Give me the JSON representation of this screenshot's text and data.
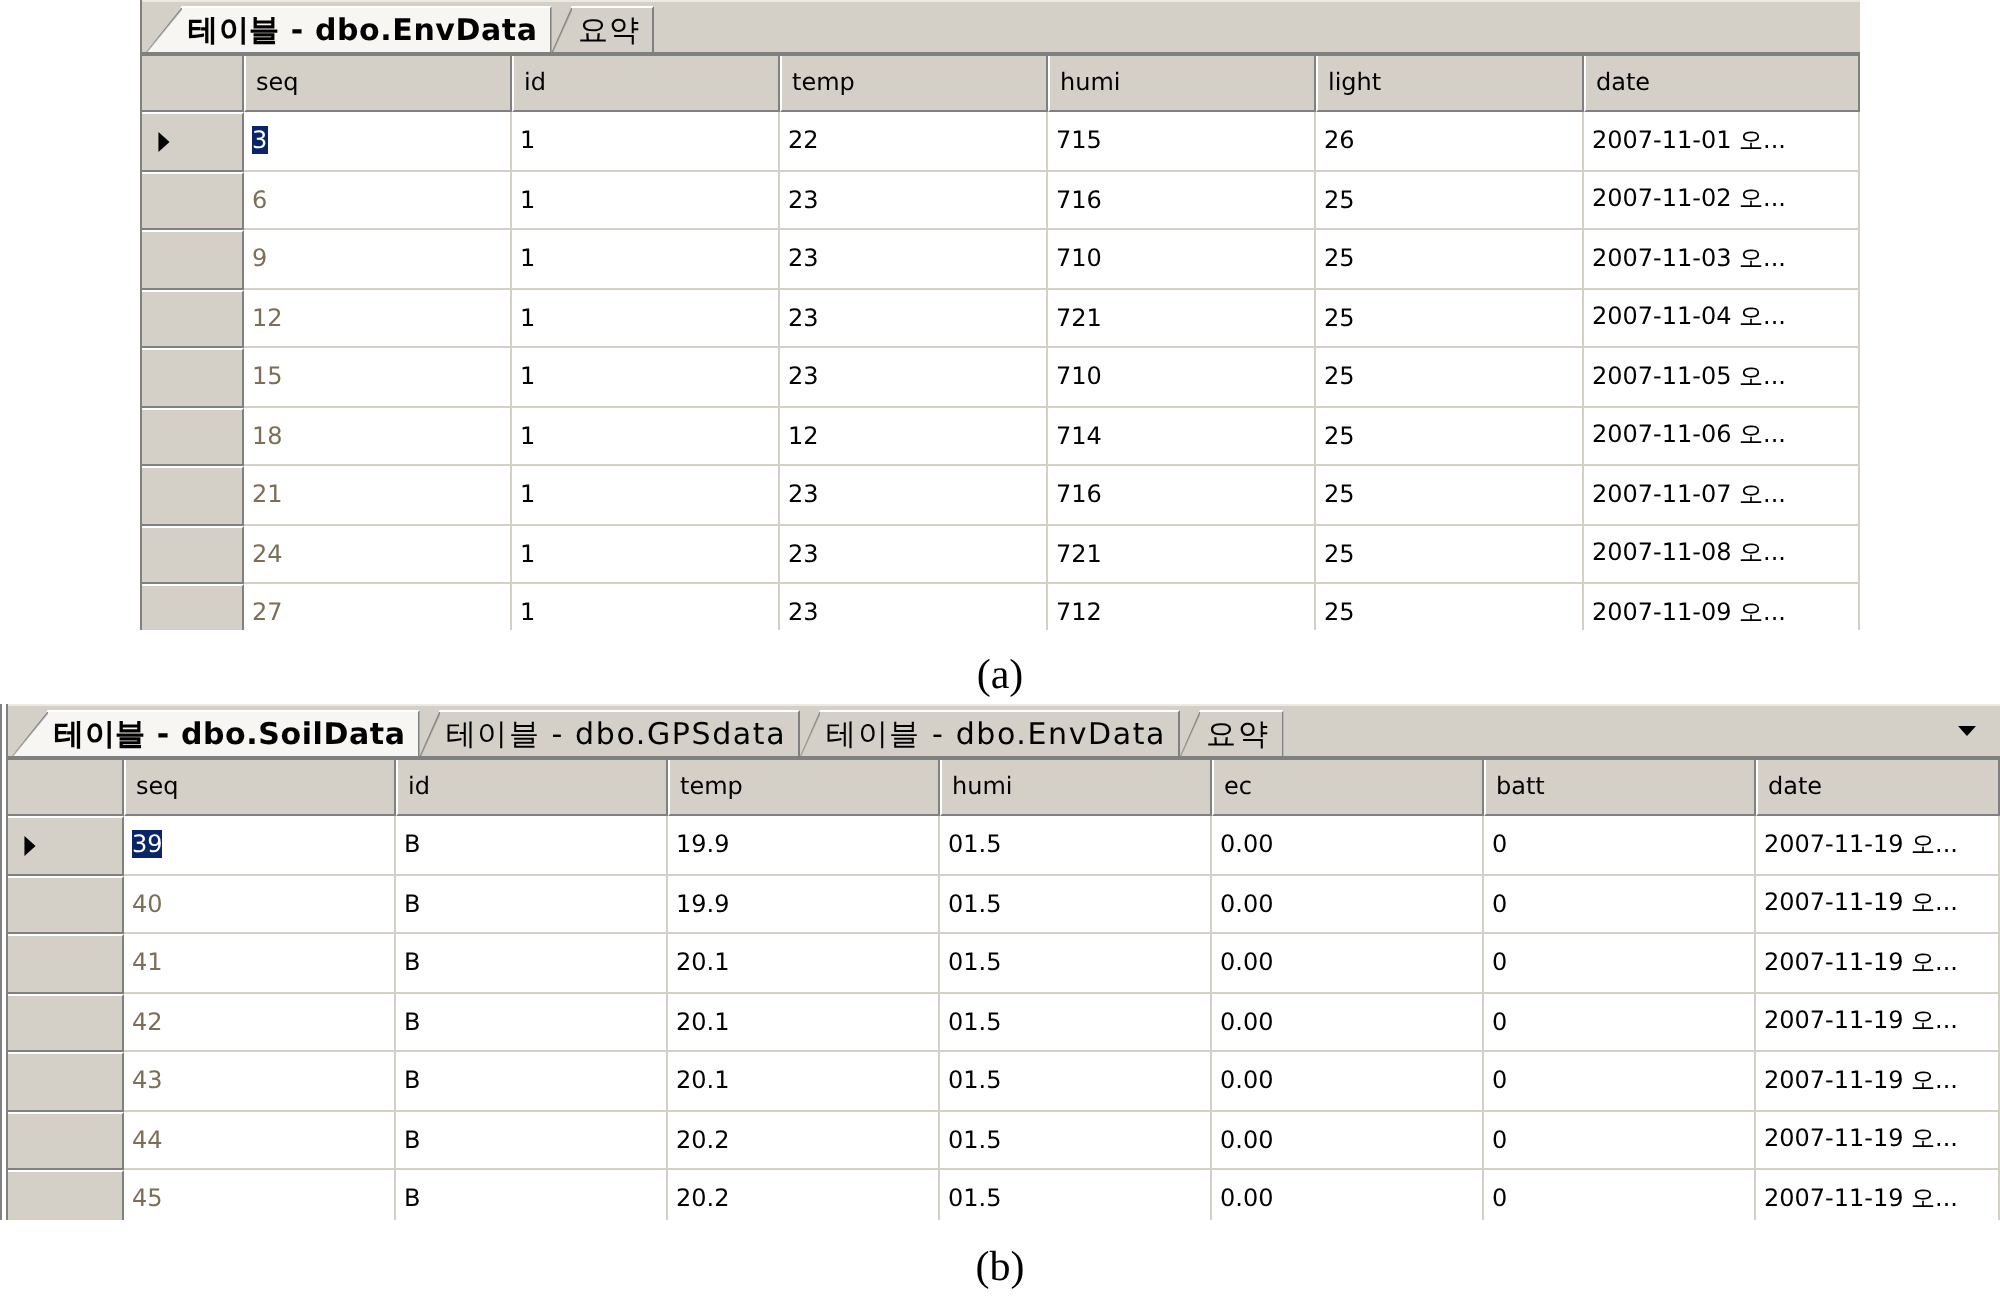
{
  "figures": [
    {
      "tabs": [
        {
          "label": "테이블 - dbo.EnvData",
          "selected": true
        },
        {
          "label": "요약",
          "selected": false
        }
      ],
      "tab_list_button": false,
      "columns": [
        {
          "label": "seq",
          "kind": "key"
        },
        {
          "label": "id",
          "kind": "data"
        },
        {
          "label": "temp",
          "kind": "data"
        },
        {
          "label": "humi",
          "kind": "data"
        },
        {
          "label": "light",
          "kind": "data"
        },
        {
          "label": "date",
          "kind": "data"
        }
      ],
      "rows": [
        {
          "selected": true,
          "cells": [
            "3",
            "1",
            "22",
            "715",
            "26",
            "2007-11-01 오..."
          ]
        },
        {
          "selected": false,
          "cells": [
            "6",
            "1",
            "23",
            "716",
            "25",
            "2007-11-02 오..."
          ]
        },
        {
          "selected": false,
          "cells": [
            "9",
            "1",
            "23",
            "710",
            "25",
            "2007-11-03 오..."
          ]
        },
        {
          "selected": false,
          "cells": [
            "12",
            "1",
            "23",
            "721",
            "25",
            "2007-11-04 오..."
          ]
        },
        {
          "selected": false,
          "cells": [
            "15",
            "1",
            "23",
            "710",
            "25",
            "2007-11-05 오..."
          ]
        },
        {
          "selected": false,
          "cells": [
            "18",
            "1",
            "12",
            "714",
            "25",
            "2007-11-06 오..."
          ]
        },
        {
          "selected": false,
          "cells": [
            "21",
            "1",
            "23",
            "716",
            "25",
            "2007-11-07 오..."
          ]
        },
        {
          "selected": false,
          "cells": [
            "24",
            "1",
            "23",
            "721",
            "25",
            "2007-11-08 오..."
          ]
        },
        {
          "selected": false,
          "cells": [
            "27",
            "1",
            "23",
            "712",
            "25",
            "2007-11-09 오..."
          ]
        }
      ],
      "caption": "(a)"
    },
    {
      "tabs": [
        {
          "label": "테이블 - dbo.SoilData",
          "selected": true
        },
        {
          "label": "테이블 - dbo.GPSdata",
          "selected": false
        },
        {
          "label": "테이블 - dbo.EnvData",
          "selected": false
        },
        {
          "label": "요약",
          "selected": false
        }
      ],
      "tab_list_button": true,
      "columns": [
        {
          "label": "seq",
          "kind": "key"
        },
        {
          "label": "id",
          "kind": "data"
        },
        {
          "label": "temp",
          "kind": "data"
        },
        {
          "label": "humi",
          "kind": "data"
        },
        {
          "label": "ec",
          "kind": "data"
        },
        {
          "label": "batt",
          "kind": "data"
        },
        {
          "label": "date",
          "kind": "data"
        }
      ],
      "rows": [
        {
          "selected": true,
          "cells": [
            "39",
            "B",
            "19.9",
            "01.5",
            "0.00",
            "0",
            "2007-11-19 오..."
          ]
        },
        {
          "selected": false,
          "cells": [
            "40",
            "B",
            "19.9",
            "01.5",
            "0.00",
            "0",
            "2007-11-19 오..."
          ]
        },
        {
          "selected": false,
          "cells": [
            "41",
            "B",
            "20.1",
            "01.5",
            "0.00",
            "0",
            "2007-11-19 오..."
          ]
        },
        {
          "selected": false,
          "cells": [
            "42",
            "B",
            "20.1",
            "01.5",
            "0.00",
            "0",
            "2007-11-19 오..."
          ]
        },
        {
          "selected": false,
          "cells": [
            "43",
            "B",
            "20.1",
            "01.5",
            "0.00",
            "0",
            "2007-11-19 오..."
          ]
        },
        {
          "selected": false,
          "cells": [
            "44",
            "B",
            "20.2",
            "01.5",
            "0.00",
            "0",
            "2007-11-19 오..."
          ]
        },
        {
          "selected": false,
          "cells": [
            "45",
            "B",
            "20.2",
            "01.5",
            "0.00",
            "0",
            "2007-11-19 오..."
          ]
        }
      ],
      "caption": "(b)"
    }
  ]
}
